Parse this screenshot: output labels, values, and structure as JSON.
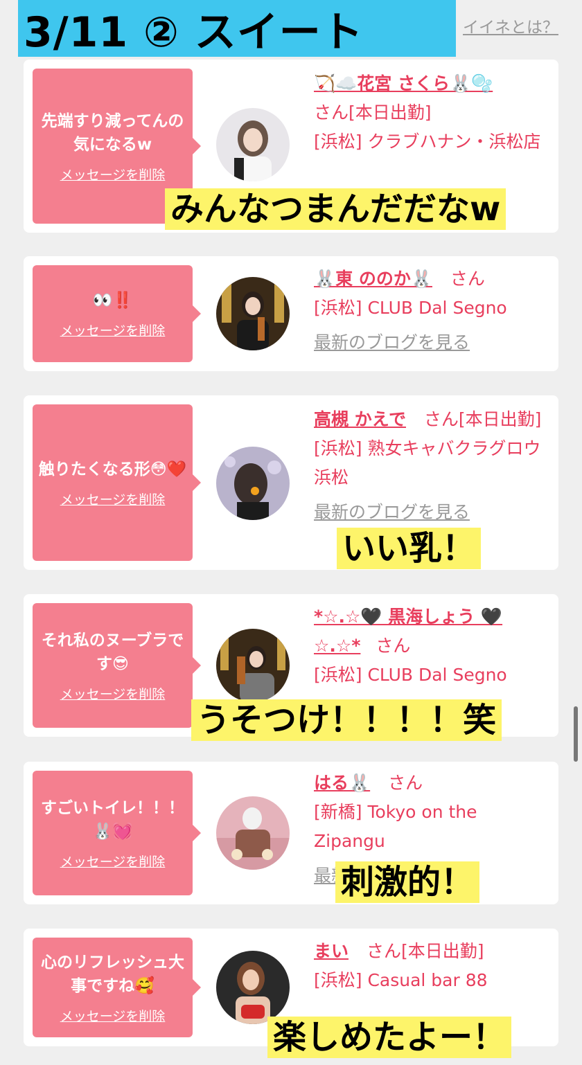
{
  "header": {
    "title": "3/11 ② スイート",
    "iine_link": "イイネとは？"
  },
  "cards": [
    {
      "message": "先端すり減ってんの気になるw",
      "delete_label": "メッセージを削除",
      "name": "🏹☁️花宮 さくら🐰🫧",
      "san": "さん[本日出勤]",
      "shop": "[浜松] クラブハナン・浜松店",
      "blog": "",
      "caption": "みんなつまんだだなw"
    },
    {
      "message": "👀‼️",
      "delete_label": "メッセージを削除",
      "name": "🐰東 ののか🐰",
      "san": "さん",
      "shop": "[浜松] CLUB Dal Segno",
      "blog": "最新のブログを見る",
      "caption": ""
    },
    {
      "message": "触りたくなる形😳❤️",
      "delete_label": "メッセージを削除",
      "name": "高槻 かえで",
      "san": "さん[本日出勤]",
      "shop": "[浜松] 熟女キャバクラグロウ 浜松",
      "blog": "最新のブログを見る",
      "caption": "いい乳！"
    },
    {
      "message": "それ私のヌーブラです😎",
      "delete_label": "メッセージを削除",
      "name": "*☆.☆🖤 黒海しょう 🖤☆.☆*",
      "san": "さん",
      "shop": "[浜松] CLUB Dal Segno",
      "blog": "",
      "caption": "うそつけ！！！！笑"
    },
    {
      "message": "すごいトイレ！！！🐰💓",
      "delete_label": "メッセージを削除",
      "name": "はる🐰",
      "san": "さん",
      "shop": "[新橋] Tokyo on the Zipangu",
      "blog": "最新のブログを見る",
      "caption": "刺激的！"
    },
    {
      "message": "心のリフレッシュ大事ですね🥰",
      "delete_label": "メッセージを削除",
      "name": "まい",
      "san": "さん[本日出勤]",
      "shop": "[浜松] Casual bar 88",
      "blog": "",
      "caption": "楽しめたよー！"
    }
  ]
}
